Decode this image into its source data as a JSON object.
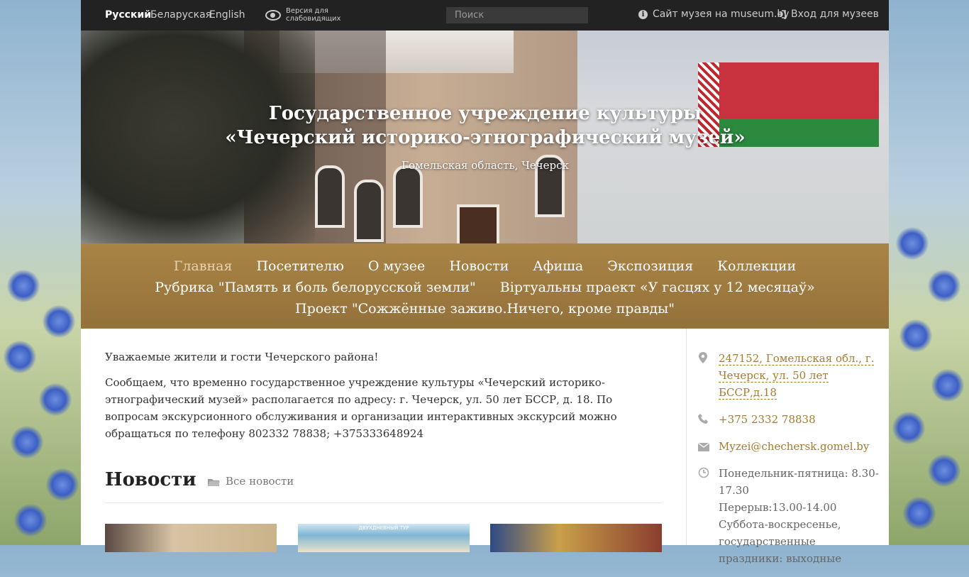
{
  "topbar": {
    "languages": [
      {
        "label": "Русский",
        "active": true
      },
      {
        "label": "Беларуская",
        "active": false
      },
      {
        "label": "English",
        "active": false
      }
    ],
    "low_vision": "Версия для слабовидящих",
    "search_placeholder": "Поиск",
    "museum_site": "Сайт музея на museum.by",
    "login": "Вход для музеев"
  },
  "hero": {
    "title": "Государственное учреждение культуры «Чечерский историко-этнографический музей»",
    "subtitle": "Гомельская область, Чечерск"
  },
  "nav": {
    "items": [
      {
        "label": "Главная",
        "active": true
      },
      {
        "label": "Посетителю"
      },
      {
        "label": "О музее"
      },
      {
        "label": "Новости"
      },
      {
        "label": "Афиша"
      },
      {
        "label": "Экспозиция"
      },
      {
        "label": "Коллекции"
      },
      {
        "label": "Рубрика \"Память и боль белорусской земли\""
      },
      {
        "label": "Віртуальны праект «У гасцях у 12 месяцаў»"
      },
      {
        "label": "Проект \"Сожжённые заживо.Ничего, кроме правды\""
      }
    ]
  },
  "main": {
    "greeting": "Уважаемые жители и гости Чечерского района!",
    "notice": "Сообщаем, что временно государственное учреждение культуры «Чечерский историко-этнографический музей» располагается по адресу: г. Чечерск, ул.  50 лет БССР, д. 18. По вопросам экскурсионного обслуживания и организации интерактивных экскурсий можно обращаться по телефону 802332 78838; +375333648924",
    "news_title": "Новости",
    "all_news": "Все новости",
    "thumb2_caption": "ДВУХДНЕВНЫЙ ТУР"
  },
  "sidebar": {
    "address": "247152, Гомельская обл., г. Чечерск, ул. 50 лет БССР,д.18",
    "phone": "+375 2332 78838",
    "email": "Myzei@chechersk.gomel.by",
    "hours": "Понедельник-пятница: 8.30-17.30\nПерерыв:13.00-14.00\nСуббота-воскресенье, государственные праздники: выходные"
  },
  "colors": {
    "topbar": "#222222",
    "nav": "#a88446",
    "accent": "#a77b2c",
    "flag_red": "#c8313e",
    "flag_green": "#2b8a3e"
  }
}
